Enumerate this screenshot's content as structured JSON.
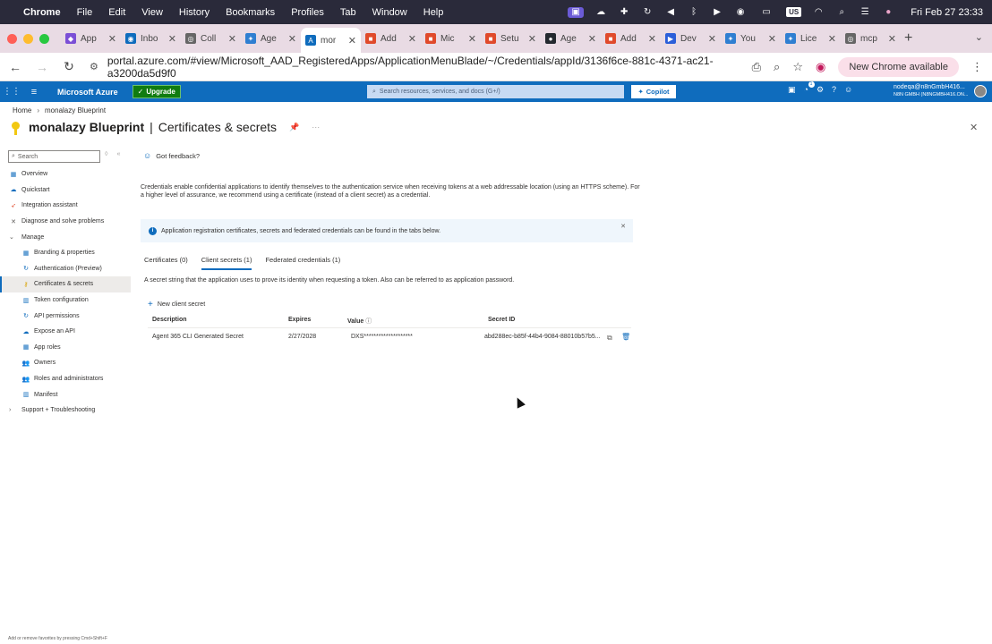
{
  "macos": {
    "app_name": "Chrome",
    "menu": [
      "File",
      "Edit",
      "View",
      "History",
      "Bookmarks",
      "Profiles",
      "Tab",
      "Window",
      "Help"
    ],
    "input_source": "US",
    "clock": "Fri Feb 27  23:33"
  },
  "tabs": [
    {
      "label": "App",
      "color": "#7b4fd6",
      "glyph": "◆",
      "active": false
    },
    {
      "label": "Inbo",
      "color": "#0f6cbd",
      "glyph": "◉",
      "active": false
    },
    {
      "label": "Coll",
      "color": "#666666",
      "glyph": "◎",
      "active": false
    },
    {
      "label": "Age",
      "color": "#2f7fd1",
      "glyph": "✦",
      "active": false
    },
    {
      "label": "mor",
      "color": "#0f6cbd",
      "glyph": "A",
      "active": true
    },
    {
      "label": "Add",
      "color": "#e04a2b",
      "glyph": "■",
      "active": false
    },
    {
      "label": "Mic",
      "color": "#e04a2b",
      "glyph": "■",
      "active": false
    },
    {
      "label": "Setu",
      "color": "#e04a2b",
      "glyph": "■",
      "active": false
    },
    {
      "label": "Age",
      "color": "#24292f",
      "glyph": "●",
      "active": false
    },
    {
      "label": "Add",
      "color": "#e04a2b",
      "glyph": "■",
      "active": false
    },
    {
      "label": "Dev",
      "color": "#2b5fd9",
      "glyph": "▶",
      "active": false
    },
    {
      "label": "You",
      "color": "#2f7fd1",
      "glyph": "✦",
      "active": false
    },
    {
      "label": "Lice",
      "color": "#2f7fd1",
      "glyph": "✦",
      "active": false
    },
    {
      "label": "mcp",
      "color": "#666666",
      "glyph": "◎",
      "active": false
    }
  ],
  "address_bar": {
    "url": "portal.azure.com/#view/Microsoft_AAD_RegisteredApps/ApplicationMenuBlade/~/Credentials/appId/3136f6ce-881c-4371-ac21-a3200da5d9f0",
    "new_chrome_label": "New Chrome available"
  },
  "azure": {
    "brand": "Microsoft Azure",
    "upgrade_label": "Upgrade",
    "search_placeholder": "Search resources, services, and docs (G+/)",
    "copilot_label": "Copilot",
    "notifications_count": "1",
    "account_email": "nodeqa@n8nGmbH416...",
    "account_tenant": "N8N GMBH (N8NGMBH416.ON..."
  },
  "breadcrumb": [
    "Home",
    "monalazy Blueprint"
  ],
  "title": {
    "app_name": "monalazy Blueprint",
    "separator": "|",
    "section": "Certificates & secrets",
    "more": "···"
  },
  "sidebar": {
    "search_placeholder": "Search",
    "items": [
      {
        "label": "Overview",
        "level": 0,
        "icon": "grid",
        "color": "#0f6cbd",
        "selected": false
      },
      {
        "label": "Quickstart",
        "level": 0,
        "icon": "cloud",
        "color": "#0f6cbd",
        "selected": false
      },
      {
        "label": "Integration assistant",
        "level": 0,
        "icon": "rocket",
        "color": "#e04a2b",
        "selected": false
      },
      {
        "label": "Diagnose and solve problems",
        "level": 0,
        "icon": "wrench",
        "color": "#605e5c",
        "selected": false
      },
      {
        "label": "Manage",
        "level": 0,
        "icon": "chevron-down",
        "color": "#605e5c",
        "selected": false
      },
      {
        "label": "Branding & properties",
        "level": 1,
        "icon": "grid",
        "color": "#0f6cbd",
        "selected": false
      },
      {
        "label": "Authentication (Preview)",
        "level": 1,
        "icon": "refresh",
        "color": "#0f6cbd",
        "selected": false
      },
      {
        "label": "Certificates & secrets",
        "level": 1,
        "icon": "key",
        "color": "#d8a300",
        "selected": true
      },
      {
        "label": "Token configuration",
        "level": 1,
        "icon": "bars",
        "color": "#0f6cbd",
        "selected": false
      },
      {
        "label": "API permissions",
        "level": 1,
        "icon": "refresh",
        "color": "#0f6cbd",
        "selected": false
      },
      {
        "label": "Expose an API",
        "level": 1,
        "icon": "cloud",
        "color": "#0f6cbd",
        "selected": false
      },
      {
        "label": "App roles",
        "level": 1,
        "icon": "grid",
        "color": "#0f6cbd",
        "selected": false
      },
      {
        "label": "Owners",
        "level": 1,
        "icon": "people",
        "color": "#0f6cbd",
        "selected": false
      },
      {
        "label": "Roles and administrators",
        "level": 1,
        "icon": "people",
        "color": "#0f6cbd",
        "selected": false
      },
      {
        "label": "Manifest",
        "level": 1,
        "icon": "bars",
        "color": "#0f6cbd",
        "selected": false
      },
      {
        "label": "Support + Troubleshooting",
        "level": 0,
        "icon": "chevron-right",
        "color": "#605e5c",
        "selected": false
      }
    ]
  },
  "main": {
    "feedback_label": "Got feedback?",
    "description": "Credentials enable confidential applications to identify themselves to the authentication service when receiving tokens at a web addressable location (using an HTTPS scheme). For a higher level of assurance, we recommend using a certificate (instead of a client secret) as a credential.",
    "info_banner": "Application registration certificates, secrets and federated credentials can be found in the tabs below.",
    "tabs": [
      {
        "label": "Certificates (0)",
        "active": false
      },
      {
        "label": "Client secrets (1)",
        "active": true
      },
      {
        "label": "Federated credentials (1)",
        "active": false
      }
    ],
    "tab_description": "A secret string that the application uses to prove its identity when requesting a token. Also can be referred to as application password.",
    "new_secret_label": "New client secret",
    "columns": [
      "Description",
      "Expires",
      "Value",
      "Secret ID"
    ],
    "rows": [
      {
        "description": "Agent 365 CLI Generated Secret",
        "expires": "2/27/2028",
        "value": "DXS********************",
        "secret_id": "abd288ec-b85f-44b4-9084-88010b57b5..."
      }
    ]
  },
  "status_text": "Add or remove favorites by pressing Cmd+Shift+F"
}
